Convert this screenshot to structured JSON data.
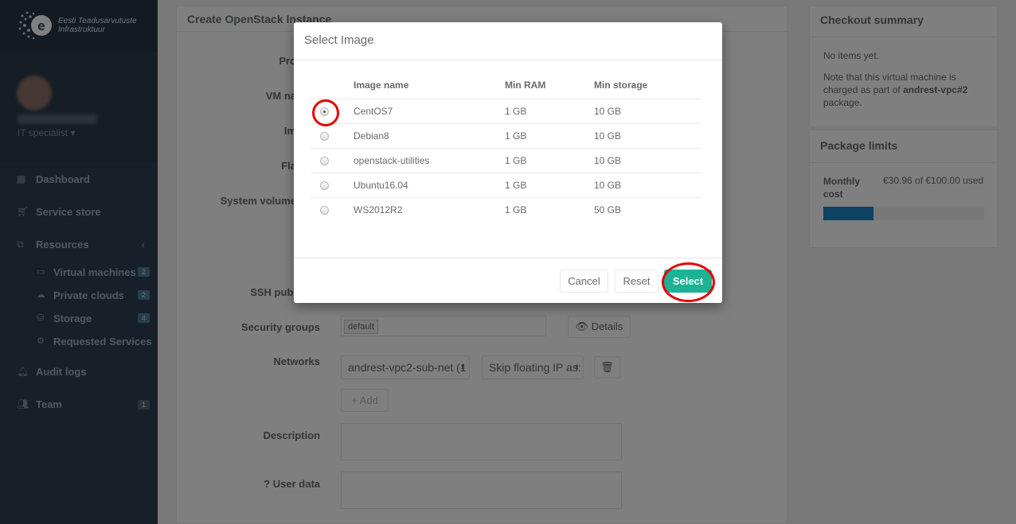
{
  "sidebar": {
    "logo_line1": "Eesti Teadusarvutuste",
    "logo_line2": "Infrastruktuur",
    "user_role": "IT specialist",
    "nav": [
      {
        "label": "Dashboard",
        "icon": "grid-icon"
      },
      {
        "label": "Service store",
        "icon": "cart-icon"
      },
      {
        "label": "Resources",
        "icon": "resources-icon"
      }
    ],
    "resources_sub": [
      {
        "label": "Virtual machines",
        "badge": "2",
        "icon": "monitor-icon"
      },
      {
        "label": "Private clouds",
        "badge": "2",
        "icon": "cloud-icon"
      },
      {
        "label": "Storage",
        "badge": "4",
        "icon": "storage-icon"
      },
      {
        "label": "Requested Services",
        "badge": "",
        "icon": "gear-icon"
      }
    ],
    "audit_logs": "Audit logs",
    "team": "Team",
    "team_badge": "1"
  },
  "form": {
    "title": "Create OpenStack Instance",
    "label_provider": "Pro",
    "label_vm_name": "VM na",
    "label_image": "Im",
    "label_flavor": "Fla",
    "label_system_volume": "System volume",
    "label_ssh": "SSH publ",
    "label_security_groups": "Security groups",
    "security_group_tag": "default",
    "details_button": "Details",
    "label_networks": "Networks",
    "network_value": "andrest-vpc2-sub-net (1",
    "floating_ip_value": "Skip floating IP as:",
    "add_button": "+ Add",
    "label_description": "Description",
    "label_user_data": "User data"
  },
  "checkout": {
    "title": "Checkout summary",
    "no_items": "No items yet.",
    "note_prefix": "Note that this virtual machine is charged as part of ",
    "note_package": "andrest-vpc#2",
    "note_suffix": " package."
  },
  "limits": {
    "title": "Package limits",
    "label": "Monthly cost",
    "used_text": "€30.96 of €100.00 used",
    "used_fraction": 0.3096
  },
  "modal": {
    "title": "Select Image",
    "columns": [
      "Image name",
      "Min RAM",
      "Min storage"
    ],
    "images": [
      {
        "name": "CentOS7",
        "ram": "1 GB",
        "storage": "10 GB"
      },
      {
        "name": "Debian8",
        "ram": "1 GB",
        "storage": "10 GB"
      },
      {
        "name": "openstack-utilities",
        "ram": "1 GB",
        "storage": "10 GB"
      },
      {
        "name": "Ubuntu16.04",
        "ram": "1 GB",
        "storage": "10 GB"
      },
      {
        "name": "WS2012R2",
        "ram": "1 GB",
        "storage": "50 GB"
      }
    ],
    "selected_index": 0,
    "cancel_label": "Cancel",
    "reset_label": "Reset",
    "select_label": "Select"
  },
  "colors": {
    "sidebar_bg": "#2f4050",
    "primary": "#1ab394",
    "highlight_circle": "#e60000",
    "progress": "#1c84c6"
  }
}
